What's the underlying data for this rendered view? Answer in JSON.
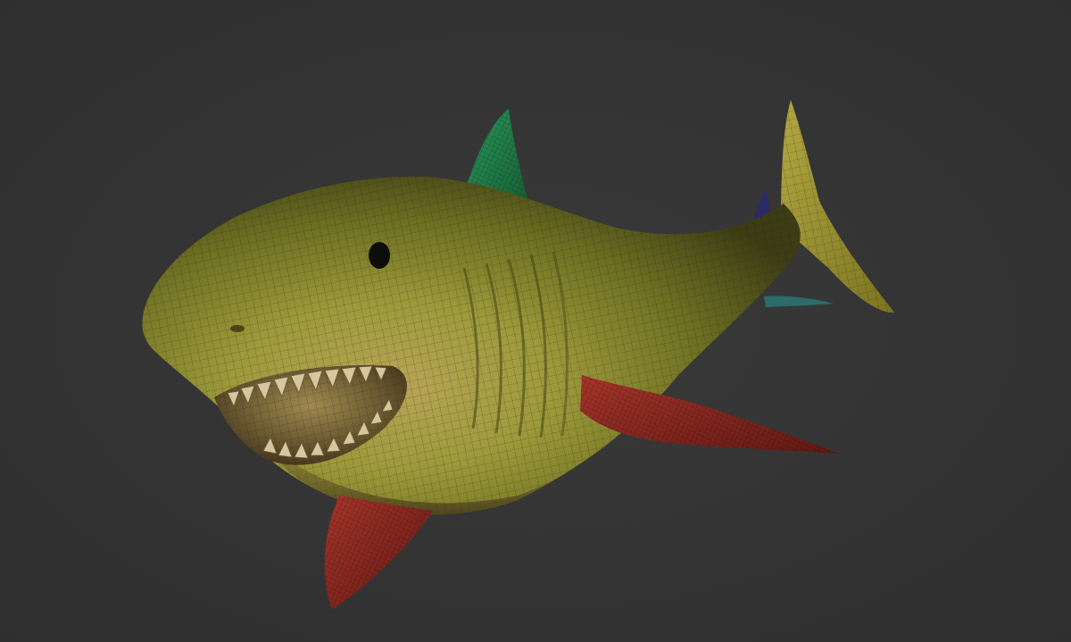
{
  "viewport": {
    "background_color": "#343434",
    "subject": "shark-model",
    "render_mode": "wireframe-over-shaded",
    "polygroup_colors": {
      "body": "#9a9a2e",
      "dorsal_fin": "#1f7a4a",
      "pectoral_fins": "#8e2a22",
      "second_dorsal_fin": "#2a2a6a",
      "anal_fin": "#2a6a6a",
      "teeth": "#c9b48a"
    }
  }
}
